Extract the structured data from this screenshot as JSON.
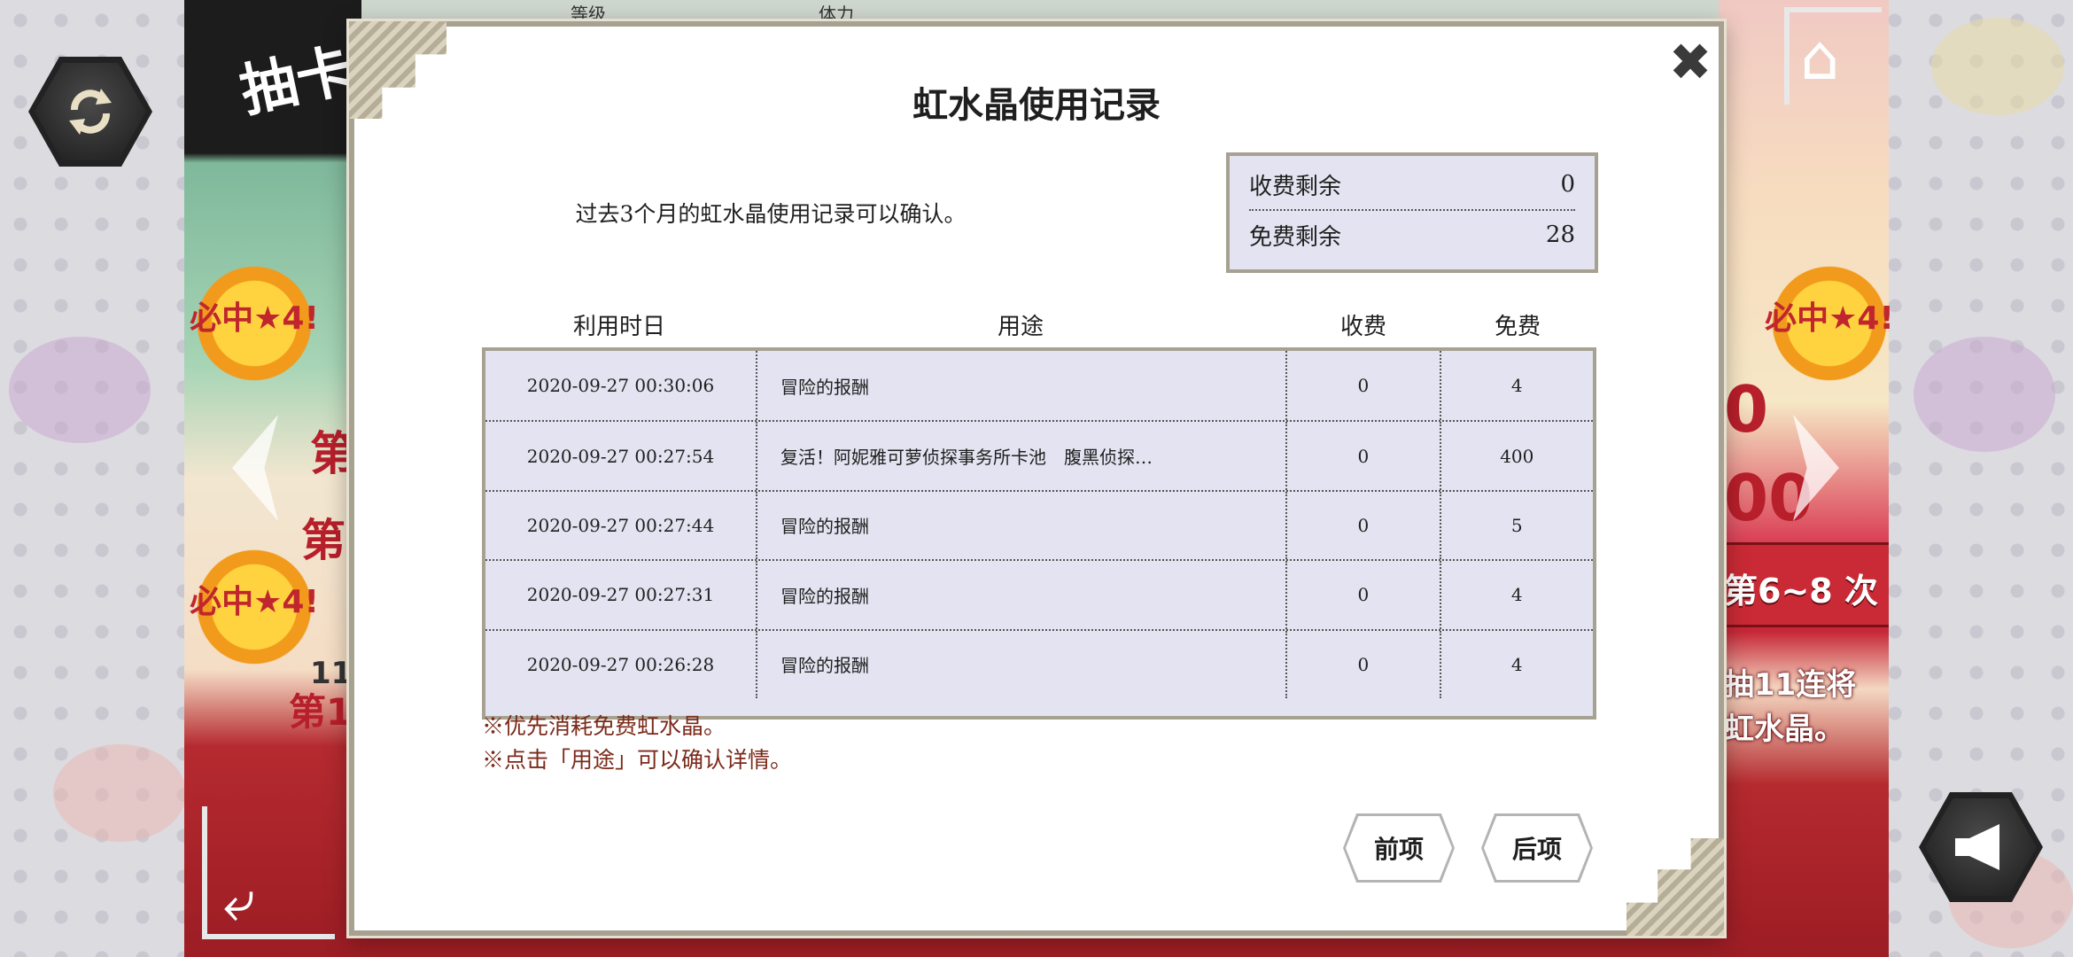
{
  "background": {
    "top_labels": [
      "等级",
      "体力"
    ],
    "banner_text": "抽卡",
    "burst_text": "必中★4!",
    "left_side_texts": [
      "第",
      "第",
      "11",
      "第1"
    ],
    "right_ribbon_text": "第6~8 次",
    "right_side_text": [
      "抽11连将",
      "虹水晶。"
    ],
    "right_numbers": [
      "0",
      "00"
    ]
  },
  "modal": {
    "title": "虹水晶使用记录",
    "description": "过去3个月的虹水晶使用记录可以确认。",
    "close_symbol": "✖",
    "balance": {
      "paid_label": "收费剩余",
      "paid_value": "0",
      "free_label": "免费剩余",
      "free_value": "28"
    },
    "table": {
      "headers": {
        "date": "利用时日",
        "use": "用途",
        "paid": "收费",
        "free": "免费"
      },
      "rows": [
        {
          "date": "2020-09-27 00:30:06",
          "use": "冒险的报酬",
          "paid": "0",
          "free": "4"
        },
        {
          "date": "2020-09-27 00:27:54",
          "use": "复活！阿妮雅可萝侦探事务所卡池　腹黑侦探…",
          "paid": "0",
          "free": "400"
        },
        {
          "date": "2020-09-27 00:27:44",
          "use": "冒险的报酬",
          "paid": "0",
          "free": "5"
        },
        {
          "date": "2020-09-27 00:27:31",
          "use": "冒险的报酬",
          "paid": "0",
          "free": "4"
        },
        {
          "date": "2020-09-27 00:26:28",
          "use": "冒险的报酬",
          "paid": "0",
          "free": "4"
        }
      ]
    },
    "notes": [
      "※优先消耗免费虹水晶。",
      "※点击「用途」可以确认详情。"
    ],
    "buttons": {
      "prev": "前项",
      "next": "后项"
    }
  },
  "icons": {
    "refresh": "refresh-icon",
    "home": "home-icon",
    "back": "back-icon",
    "sound": "speaker-icon",
    "close": "close-icon"
  },
  "colors": {
    "table_bg": "#e3e3f1",
    "frame": "#a7a191",
    "note_text": "#7c2a1a"
  }
}
